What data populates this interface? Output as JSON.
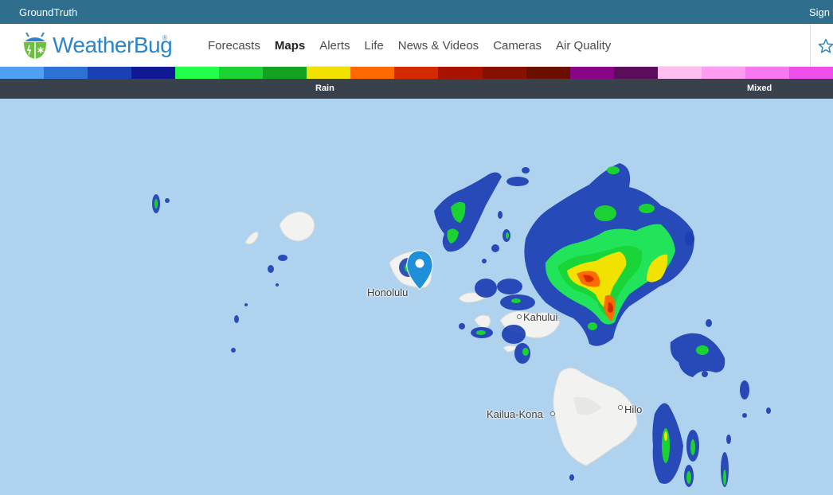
{
  "topbar": {
    "brand": "GroundTruth",
    "signin": "Sign"
  },
  "logo": {
    "text": "WeatherBug",
    "reg": "®"
  },
  "nav": {
    "items": [
      "Forecasts",
      "Maps",
      "Alerts",
      "Life",
      "News & Videos",
      "Cameras",
      "Air Quality"
    ],
    "active": "Maps"
  },
  "legend": {
    "colors": [
      "#4f9ff2",
      "#2d71d4",
      "#1c3fb4",
      "#0f1993",
      "#22ff4a",
      "#1ad333",
      "#12a21f",
      "#f2e200",
      "#ff6a00",
      "#d42a00",
      "#aa1200",
      "#881000",
      "#6a0e00",
      "#880588",
      "#5b0c5b",
      "#ffc0f0",
      "#ff9df0",
      "#f778ef",
      "#ee4ee9"
    ],
    "label_rain": "Rain",
    "label_mixed": "Mixed"
  },
  "map": {
    "cities": [
      "Honolulu",
      "Kahului",
      "Kailua-Kona",
      "Hilo"
    ],
    "water_color": "#afd2ee",
    "land_color": "#f2f2f0",
    "marker_color": "#1f8fd9"
  }
}
